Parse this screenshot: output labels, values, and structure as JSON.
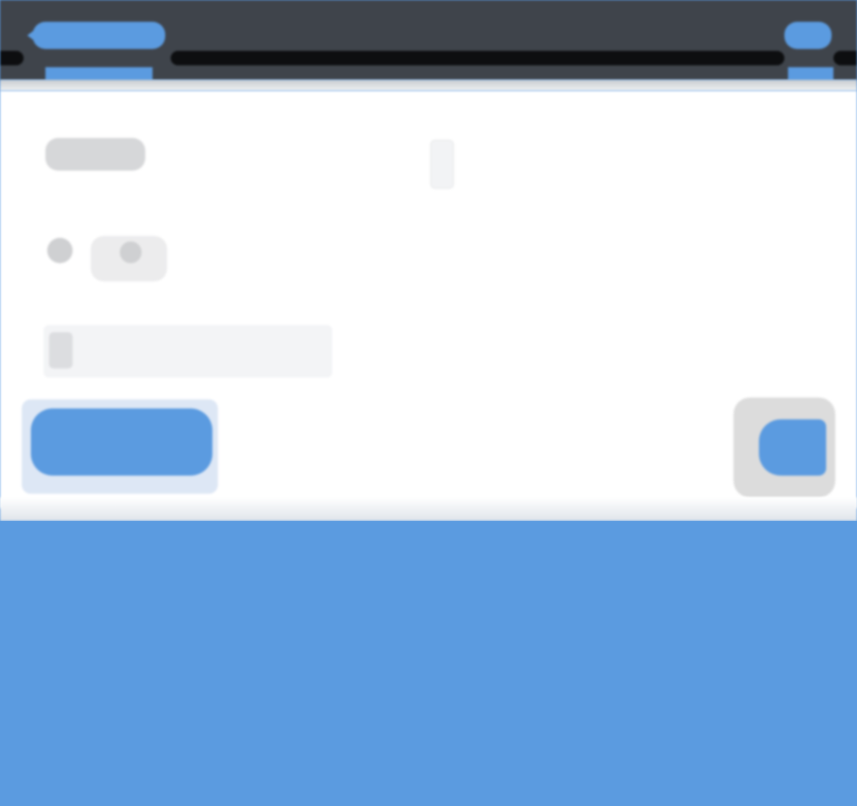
{
  "header": {
    "back_label": "",
    "action_label": "",
    "tabs": [
      {
        "label": ""
      },
      {
        "label": ""
      }
    ]
  },
  "form": {
    "row1_label": "",
    "row2_label": "",
    "row3_text": ""
  },
  "buttons": {
    "primary_label": "",
    "fab_label": ""
  },
  "colors": {
    "accent": "#5b9be0",
    "topbar": "#3f444b",
    "panel": "#ffffff"
  }
}
